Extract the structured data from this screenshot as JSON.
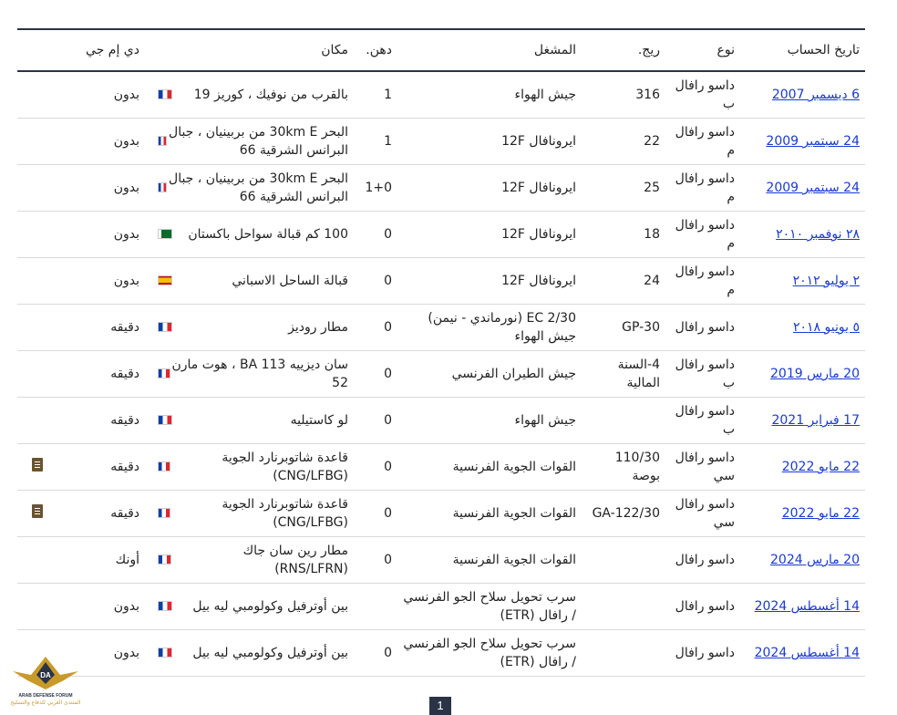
{
  "headers": {
    "date": "تاريخ الحساب",
    "type": "نوع",
    "reg": "ريج.",
    "operator": "المشغل",
    "fat": "دهن.",
    "location": "مكان",
    "dmg": "دي إم جي"
  },
  "rows": [
    {
      "date": "6 ديسمبر 2007",
      "type": "داسو رافال ب",
      "reg": "316",
      "operator": "جيش الهواء",
      "fat": "1",
      "location": "بالقرب من نوفيك ، كوريز 19",
      "flag": "fr",
      "dmg": "بدون",
      "doc": false
    },
    {
      "date": "24 سبتمبر 2009",
      "type": "داسو رافال م",
      "reg": "22",
      "operator": "ايرونافال 12F",
      "fat": "1",
      "location": "البحر 30km E من بربينيان ، جبال البرانس الشرقية 66",
      "flag": "fr",
      "dmg": "بدون",
      "doc": false
    },
    {
      "date": "24 سبتمبر 2009",
      "type": "داسو رافال م",
      "reg": "25",
      "operator": "ايرونافال 12F",
      "fat": "1+0",
      "location": "البحر 30km E من بربينيان ، جبال البرانس الشرقية 66",
      "flag": "fr",
      "dmg": "بدون",
      "doc": false
    },
    {
      "date": "٢٨ نوفمبر ٢٠١٠",
      "type": "داسو رافال م",
      "reg": "18",
      "operator": "ايرونافال 12F",
      "fat": "0",
      "location": "100 كم قبالة سواحل باكستان",
      "flag": "pk",
      "dmg": "بدون",
      "doc": false
    },
    {
      "date": "٢ يوليو ٢٠١٢",
      "type": "داسو رافال م",
      "reg": "24",
      "operator": "ايرونافال 12F",
      "fat": "0",
      "location": "قبالة الساحل الاسباني",
      "flag": "es",
      "dmg": "بدون",
      "doc": false
    },
    {
      "date": "٥ يونيو ٢٠١٨",
      "type": "داسو رافال",
      "reg": "GP-30",
      "operator": "EC 2/30 (نورماندي - نيمن) جيش الهواء",
      "fat": "0",
      "location": "مطار روديز",
      "flag": "fr",
      "dmg": "دقيقه",
      "doc": false
    },
    {
      "date": "20 مارس 2019",
      "type": "داسو رافال ب",
      "reg": "4-السنة المالية",
      "operator": "جيش الطيران الفرنسي",
      "fat": "0",
      "location": "سان ديزييه BA 113 ، هوت مارن 52",
      "flag": "fr",
      "dmg": "دقيقه",
      "doc": false
    },
    {
      "date": "17 فبراير 2021",
      "type": "داسو رافال ب",
      "reg": "",
      "operator": "جيش الهواء",
      "fat": "0",
      "location": "لو كاستيليه",
      "flag": "fr",
      "dmg": "دقيقه",
      "doc": false
    },
    {
      "date": "22 مايو 2022",
      "type": "داسو رافال سي",
      "reg": "110/30 بوصة",
      "operator": "القوات الجوية الفرنسية",
      "fat": "0",
      "location": "قاعدة شاتوبرنارد الجوية (CNG/LFBG)",
      "flag": "fr",
      "dmg": "دقيقه",
      "doc": true
    },
    {
      "date": "22 مايو 2022",
      "type": "داسو رافال سي",
      "reg": "GA-122/30",
      "operator": "القوات الجوية الفرنسية",
      "fat": "0",
      "location": "قاعدة شاتوبرنارد الجوية (CNG/LFBG)",
      "flag": "fr",
      "dmg": "دقيقه",
      "doc": true
    },
    {
      "date": "20 مارس 2024",
      "type": "داسو رافال",
      "reg": "",
      "operator": "القوات الجوية الفرنسية",
      "fat": "0",
      "location": "مطار رين سان جاك (RNS/LFRN)",
      "flag": "fr",
      "dmg": "أونك",
      "doc": false
    },
    {
      "date": "14 أغسطس 2024",
      "type": "داسو رافال",
      "reg": "",
      "operator": "سرب تحويل سلاح الجو الفرنسي / رافال (ETR)",
      "fat": "",
      "location": "بين أوترفيل وكولومبي ليه بيل",
      "flag": "fr",
      "dmg": "بدون",
      "doc": false
    },
    {
      "date": "14 أغسطس 2024",
      "type": "داسو رافال",
      "reg": "",
      "operator": "سرب تحويل سلاح الجو الفرنسي / رافال (ETR)",
      "fat": "0",
      "location": "بين أوترفيل وكولومبي ليه بيل",
      "flag": "fr",
      "dmg": "بدون",
      "doc": false
    }
  ],
  "pagination": {
    "current": "1"
  },
  "watermark": {
    "line1": "ARAB DEFENSE FORUM",
    "line2": "المنتدى العربي للدفاع والتسليح"
  },
  "colors": {
    "link": "#1a3ad0",
    "header_rule": "#2a3446",
    "doc_icon": "#6a5330"
  }
}
